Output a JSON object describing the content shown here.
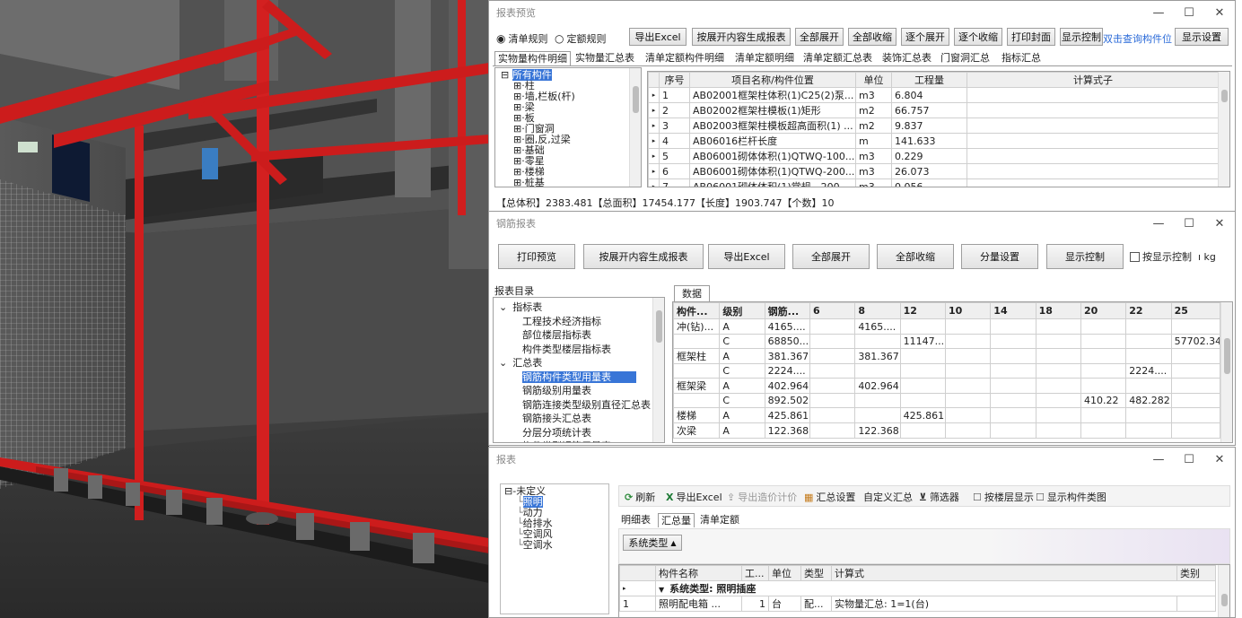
{
  "report_preview": {
    "title": "报表预览",
    "radio_list_rule": "清单规则",
    "radio_quota_rule": "定额规则",
    "buttons": [
      "导出Excel",
      "按展开内容生成报表",
      "全部展开",
      "全部收缩",
      "逐个展开",
      "逐个收缩",
      "打印封面",
      "显示控制"
    ],
    "link_text": "双击查询构件位",
    "display_settings": "显示设置",
    "tabs": [
      "实物量构件明细",
      "实物量汇总表",
      "清单定额构件明细",
      "清单定额明细",
      "清单定额汇总表",
      "装饰汇总表",
      "门窗洞汇总",
      "指标汇总"
    ],
    "tree_root": "所有构件",
    "tree_items": [
      "柱",
      "墙,栏板(杆)",
      "梁",
      "板",
      "门窗洞",
      "圈,反,过梁",
      "基础",
      "零星",
      "楼梯",
      "桩基"
    ],
    "columns": [
      "序号",
      "项目名称/构件位置",
      "单位",
      "工程量",
      "计算式子"
    ],
    "rows": [
      [
        "1",
        "AB02001框架柱体积(1)C25(2)泵...",
        "m3",
        "6.804"
      ],
      [
        "2",
        "AB02002框架柱模板(1)矩形",
        "m2",
        "66.757"
      ],
      [
        "3",
        "AB02003框架柱模板超高面积(1) ...",
        "m2",
        "9.837"
      ],
      [
        "4",
        "AB06016栏杆长度",
        "m",
        "141.633"
      ],
      [
        "5",
        "AB06001砌体体积(1)QTWQ-100...",
        "m3",
        "0.229"
      ],
      [
        "6",
        "AB06001砌体体积(1)QTWQ-200...",
        "m3",
        "26.073"
      ],
      [
        "7",
        "AB06001砌体体积(1)常规 - 200...",
        "m3",
        "0.056"
      ]
    ],
    "summary": "【总体积】2383.481【总面积】17454.177【长度】1903.747【个数】10"
  },
  "rebar_report": {
    "title": "钢筋报表",
    "buttons": [
      "打印预览",
      "按展开内容生成报表",
      "导出Excel",
      "全部展开",
      "全部收缩",
      "分量设置",
      "显示控制"
    ],
    "checkbox_label": "按显示控制",
    "unit_text": "ı kg",
    "catalog_label": "报表目录",
    "data_tab": "数据",
    "tree": [
      {
        "label": "指标表",
        "level": 0,
        "expander": "⌄"
      },
      {
        "label": "工程技术经济指标",
        "level": 1
      },
      {
        "label": "部位楼层指标表",
        "level": 1
      },
      {
        "label": "构件类型楼层指标表",
        "level": 1
      },
      {
        "label": "汇总表",
        "level": 0,
        "expander": "⌄"
      },
      {
        "label": "钢筋构件类型用量表",
        "level": 1,
        "selected": true
      },
      {
        "label": "钢筋级别用量表",
        "level": 1
      },
      {
        "label": "钢筋连接类型级别直径汇总表",
        "level": 1
      },
      {
        "label": "钢筋接头汇总表",
        "level": 1
      },
      {
        "label": "分层分项统计表",
        "level": 1
      },
      {
        "label": "构件类型钢筋用量表",
        "level": 1
      }
    ],
    "columns": [
      "构件...",
      "级别",
      "钢筋...",
      "6",
      "8",
      "12",
      "10",
      "14",
      "18",
      "20",
      "22",
      "25"
    ],
    "rows": [
      [
        "冲(钻)...",
        "A",
        "4165....",
        "",
        "4165....",
        "",
        "",
        "",
        "",
        "",
        "",
        ""
      ],
      [
        "",
        "C",
        "68850...",
        "",
        "",
        "11147...",
        "",
        "",
        "",
        "",
        "",
        "57702.34"
      ],
      [
        "框架柱",
        "A",
        "381.367",
        "",
        "381.367",
        "",
        "",
        "",
        "",
        "",
        "",
        ""
      ],
      [
        "",
        "C",
        "2224....",
        "",
        "",
        "",
        "",
        "",
        "",
        "",
        "2224....",
        ""
      ],
      [
        "框架梁",
        "A",
        "402.964",
        "",
        "402.964",
        "",
        "",
        "",
        "",
        "",
        "",
        ""
      ],
      [
        "",
        "C",
        "892.502",
        "",
        "",
        "",
        "",
        "",
        "",
        "410.22",
        "482.282",
        ""
      ],
      [
        "楼梯",
        "A",
        "425.861",
        "",
        "",
        "425.861",
        "",
        "",
        "",
        "",
        "",
        ""
      ],
      [
        "次梁",
        "A",
        "122.368",
        "",
        "122.368",
        "",
        "",
        "",
        "",
        "",
        "",
        ""
      ]
    ]
  },
  "mep_report": {
    "title": "报表",
    "tree_root": "未定义",
    "tree_items": [
      "照明",
      "动力",
      "给排水",
      "空调风",
      "空调水"
    ],
    "toolbar": [
      "刷新",
      "导出Excel",
      "导出造价计价",
      "汇总设置",
      "自定义汇总",
      "筛选器",
      "按楼层显示",
      "显示构件类图"
    ],
    "tabs": [
      "明细表",
      "汇总量",
      "清单定额"
    ],
    "group_by": "系统类型",
    "columns": [
      "构件名称",
      "工...",
      "单位",
      "类型",
      "计算式",
      "类别"
    ],
    "group_row": "系统类型: 照明插座",
    "rows": [
      [
        "1",
        "照明配电箱 ...",
        "1",
        "台",
        "配...",
        "实物量汇总: 1=1(台)"
      ]
    ]
  }
}
